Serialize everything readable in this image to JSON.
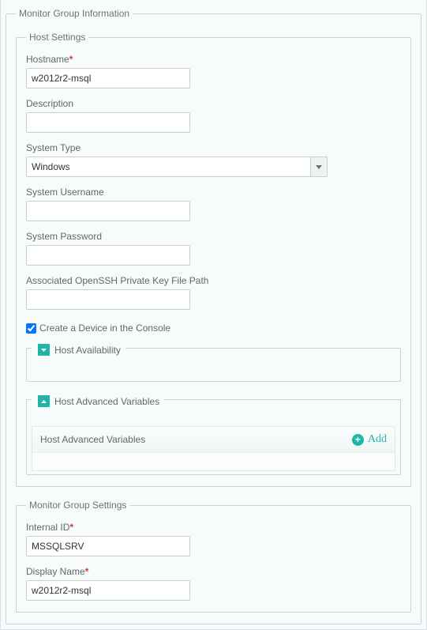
{
  "groups": {
    "monitor_group_info_legend": "Monitor Group Information",
    "host_settings_legend": "Host Settings",
    "monitor_group_settings_legend": "Monitor Group Settings"
  },
  "host": {
    "hostname_label": "Hostname",
    "hostname_value": "w2012r2-msql",
    "description_label": "Description",
    "description_value": "",
    "system_type_label": "System Type",
    "system_type_value": "Windows",
    "system_username_label": "System Username",
    "system_username_value": "",
    "system_password_label": "System Password",
    "system_password_value": "",
    "ssh_key_path_label": "Associated OpenSSH Private Key File Path",
    "ssh_key_path_value": "",
    "create_device_label": "Create a Device in the Console",
    "create_device_checked": true,
    "availability_label": "Host Availability",
    "advanced_vars_label": "Host Advanced Variables",
    "advanced_vars_bar_label": "Host Advanced Variables",
    "add_label": "Add"
  },
  "monitor_group": {
    "internal_id_label": "Internal ID",
    "internal_id_value": "MSSQLSRV",
    "display_name_label": "Display Name",
    "display_name_value": "w2012r2-msql"
  }
}
